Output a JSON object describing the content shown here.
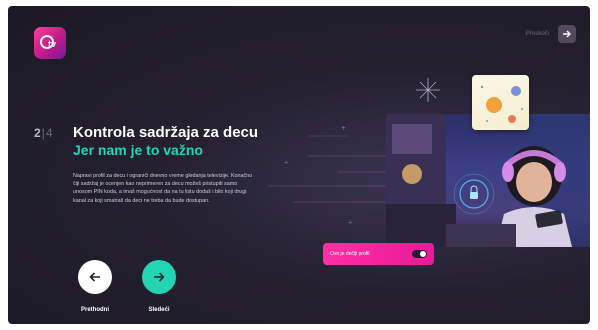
{
  "app": {
    "logo_icon": "tv-icon",
    "brand_color": "#e8199a",
    "accent_color": "#1ed7b5"
  },
  "header": {
    "skip_label": "Preskoči",
    "skip_icon": "arrow-right-icon"
  },
  "content": {
    "step_current": "2",
    "step_total": "4",
    "title": "Kontrola sadržaja za decu",
    "subtitle": "Jer nam je to važno",
    "description": "Napravi profil za decu i ograniči dnevno vreme gledanja televizije. Konačno čiji sadržaj je ocenjen kao neprimeren za decu možeš pristupiti samo unosom PIN koda, a imaš mogućnost da na tu listu dodaš i bilo koji drugi kanal za koji smatraš da deci ne treba da bude dostupan."
  },
  "navigation": {
    "prev_label": "Prethodni",
    "prev_icon": "arrow-left-icon",
    "next_label": "Sledeći",
    "next_icon": "arrow-right-icon"
  },
  "illustration": {
    "toggle_label": "Ovo je dečiji profil",
    "toggle_on": true
  }
}
